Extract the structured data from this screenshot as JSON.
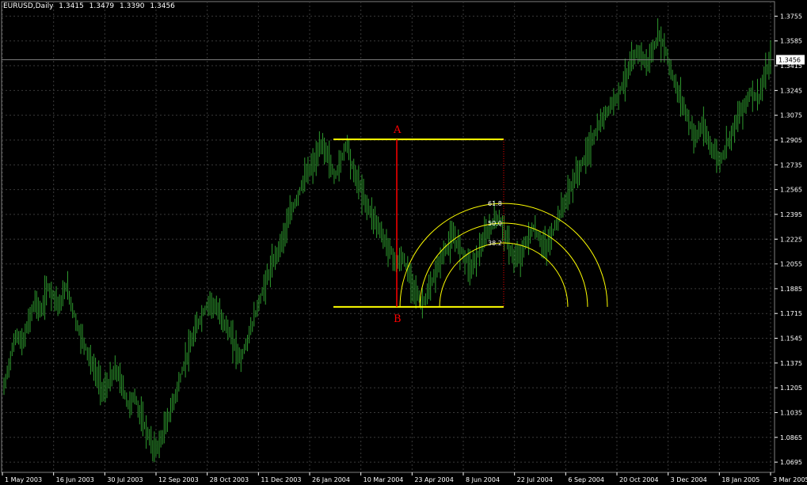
{
  "header": {
    "symbol_timeframe": "EURUSD,Daily",
    "ohlc": [
      "1.3415",
      "1.3479",
      "1.3390",
      "1.3456"
    ]
  },
  "current_price_label": "1.3456",
  "chart_data": {
    "type": "line",
    "title": "EURUSD,Daily",
    "x_tick_labels": [
      "1 May 2003",
      "16 Jun 2003",
      "30 Jul 2003",
      "12 Sep 2003",
      "28 Oct 2003",
      "11 Dec 2003",
      "26 Jan 2004",
      "10 Mar 2004",
      "23 Apr 2004",
      "8 Jun 2004",
      "22 Jul 2004",
      "6 Sep 2004",
      "20 Oct 2004",
      "3 Dec 2004",
      "18 Jan 2005",
      "3 Mar 2005"
    ],
    "y_tick_labels": [
      "1.3755",
      "1.3585",
      "1.3415",
      "1.3245",
      "1.3075",
      "1.2905",
      "1.2735",
      "1.2565",
      "1.2395",
      "1.2225",
      "1.2055",
      "1.1885",
      "1.1715",
      "1.1545",
      "1.1375",
      "1.1205",
      "1.1035",
      "1.0865",
      "1.0695"
    ],
    "ylim": [
      1.0625,
      1.3855
    ],
    "grid": true,
    "series": [
      {
        "values": [
          1.12,
          1.14,
          1.158,
          1.15,
          1.166,
          1.18,
          1.172,
          1.19,
          1.184,
          1.176,
          1.191,
          1.175,
          1.16,
          1.15,
          1.138,
          1.128,
          1.118,
          1.125,
          1.133,
          1.122,
          1.108,
          1.115,
          1.1,
          1.09,
          1.078,
          1.082,
          1.095,
          1.108,
          1.122,
          1.138,
          1.15,
          1.163,
          1.172,
          1.18,
          1.175,
          1.168,
          1.16,
          1.15,
          1.14,
          1.152,
          1.166,
          1.18,
          1.193,
          1.204,
          1.215,
          1.226,
          1.24,
          1.25,
          1.262,
          1.27,
          1.276,
          1.288,
          1.28,
          1.265,
          1.275,
          1.29,
          1.27,
          1.26,
          1.248,
          1.24,
          1.232,
          1.222,
          1.215,
          1.205,
          1.21,
          1.198,
          1.188,
          1.178,
          1.184,
          1.196,
          1.208,
          1.216,
          1.224,
          1.218,
          1.21,
          1.203,
          1.212,
          1.222,
          1.23,
          1.238,
          1.232,
          1.218,
          1.208,
          1.212,
          1.222,
          1.23,
          1.222,
          1.216,
          1.226,
          1.238,
          1.248,
          1.258,
          1.268,
          1.276,
          1.286,
          1.296,
          1.304,
          1.312,
          1.318,
          1.326,
          1.336,
          1.346,
          1.352,
          1.342,
          1.35,
          1.362,
          1.355,
          1.338,
          1.325,
          1.315,
          1.302,
          1.292,
          1.3,
          1.29,
          1.282,
          1.276,
          1.288,
          1.298,
          1.308,
          1.316,
          1.324,
          1.318,
          1.332,
          1.345
        ]
      }
    ],
    "fibonacci": {
      "point_a_label": "A",
      "point_b_label": "B",
      "high": 1.291,
      "low": 1.176,
      "levels": [
        {
          "ratio": "61.8"
        },
        {
          "ratio": "50.0"
        },
        {
          "ratio": "38.2"
        }
      ]
    },
    "current_price": 1.3456,
    "colors": {
      "background": "#000000",
      "bars": "#2e9a2e",
      "grid": "#3a3a3a",
      "axis": "#ffffff",
      "fib_lines": "#ffff00",
      "fib_vertical": "#ff0000",
      "fib_labels": "#ffffff",
      "ab_labels": "#ff0000"
    }
  }
}
